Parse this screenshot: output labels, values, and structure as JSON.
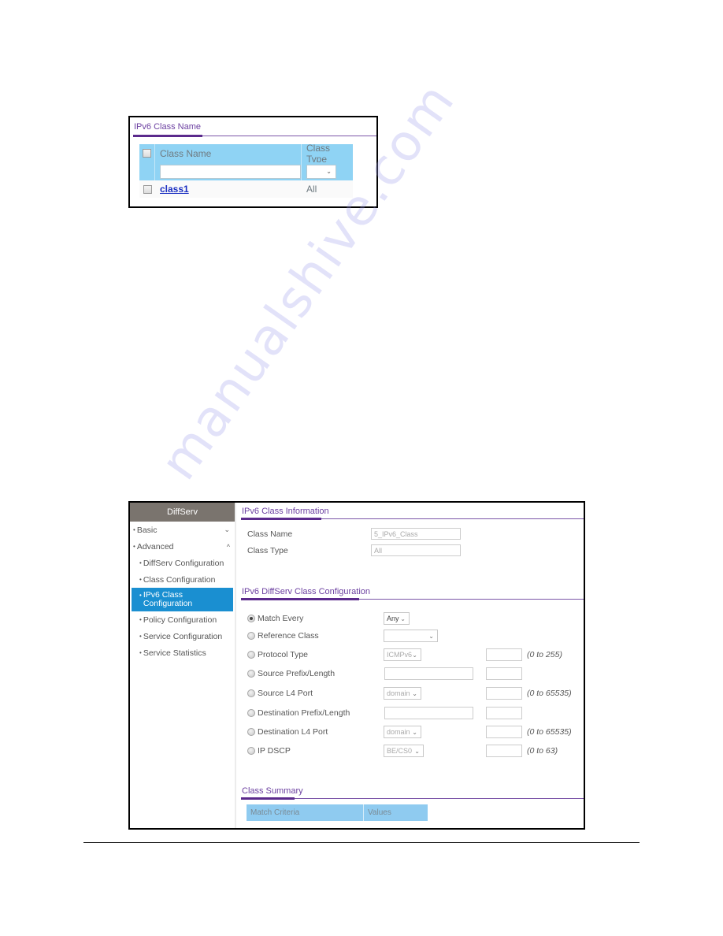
{
  "screenshot1": {
    "section_title": "IPv6 Class Name",
    "table": {
      "columns": [
        "Class Name",
        "Class Type"
      ],
      "filter": {
        "class_name": "",
        "class_type": ""
      },
      "rows": [
        {
          "checked": false,
          "class_name": "class1",
          "class_type": "All"
        }
      ]
    },
    "icons": {
      "dropdown": "⌄"
    }
  },
  "screenshot2": {
    "sidebar": {
      "header": "DiffServ",
      "items": [
        {
          "label": "Basic",
          "level": "top",
          "caret": "⌄",
          "expanded": false
        },
        {
          "label": "Advanced",
          "level": "top",
          "caret": "^",
          "expanded": true
        },
        {
          "label": "DiffServ Configuration",
          "level": "sub"
        },
        {
          "label": "Class Configuration",
          "level": "sub"
        },
        {
          "label": "IPv6 Class Configuration",
          "level": "sub",
          "active": true
        },
        {
          "label": "Policy Configuration",
          "level": "sub"
        },
        {
          "label": "Service Configuration",
          "level": "sub"
        },
        {
          "label": "Service Statistics",
          "level": "sub"
        }
      ],
      "bullet": "•"
    },
    "info": {
      "section_title": "IPv6 Class Information",
      "class_name_label": "Class Name",
      "class_name_value": "5_IPv6_Class",
      "class_type_label": "Class Type",
      "class_type_value": "All"
    },
    "config": {
      "section_title": "IPv6 DiffServ Class Configuration",
      "rows": [
        {
          "label": "Match Every",
          "selected": true,
          "select_value": "Any",
          "select_enabled": true,
          "text_input": false,
          "number_input": false,
          "range": ""
        },
        {
          "label": "Reference Class",
          "selected": false,
          "select_value": "",
          "select_enabled": true,
          "text_input": false,
          "number_input": false,
          "range": ""
        },
        {
          "label": "Protocol Type",
          "selected": false,
          "select_value": "ICMPv6",
          "select_enabled": false,
          "text_input": false,
          "number_input": true,
          "range": "(0 to 255)"
        },
        {
          "label": "Source Prefix/Length",
          "selected": false,
          "select_value": null,
          "text_input": true,
          "number_input": true,
          "range": ""
        },
        {
          "label": "Source L4 Port",
          "selected": false,
          "select_value": "domain",
          "select_enabled": false,
          "text_input": false,
          "number_input": true,
          "range": "(0 to 65535)"
        },
        {
          "label": "Destination Prefix/Length",
          "selected": false,
          "select_value": null,
          "text_input": true,
          "number_input": true,
          "range": ""
        },
        {
          "label": "Destination L4 Port",
          "selected": false,
          "select_value": "domain",
          "select_enabled": false,
          "text_input": false,
          "number_input": true,
          "range": "(0 to 65535)"
        },
        {
          "label": "IP DSCP",
          "selected": false,
          "select_value": "BE/CS0",
          "select_enabled": false,
          "text_input": false,
          "number_input": true,
          "range": "(0 to 63)"
        }
      ]
    },
    "summary": {
      "section_title": "Class Summary",
      "columns": [
        "Match Criteria",
        "Values"
      ]
    }
  },
  "watermark": "manualshive.com",
  "colors": {
    "section_title": "#6b3fa0",
    "table_header": "#8fd3f4",
    "sidebar_header": "#7a746e",
    "sidebar_active": "#1a8fd1",
    "link": "#1b2fc2"
  }
}
